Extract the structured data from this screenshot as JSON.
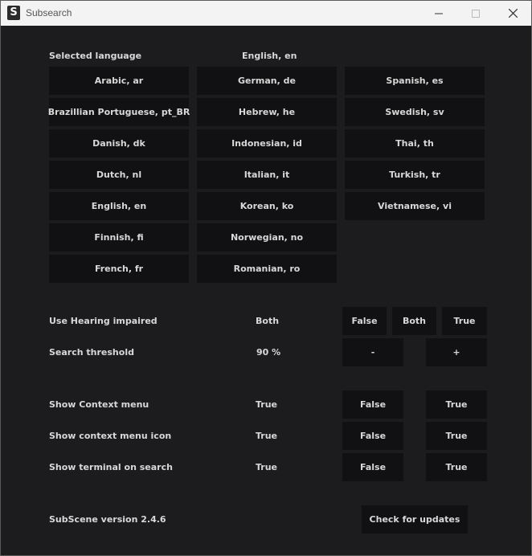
{
  "window": {
    "title": "Subsearch",
    "icon_letter": "S"
  },
  "languages": {
    "label": "Selected language",
    "selected": "English, en",
    "col1": [
      "Arabic, ar",
      "Brazillian Portuguese, pt_BR",
      "Danish, dk",
      "Dutch, nl",
      "English, en",
      "Finnish, fi",
      "French, fr"
    ],
    "col2": [
      "German, de",
      "Hebrew, he",
      "Indonesian, id",
      "Italian, it",
      "Korean, ko",
      "Norwegian, no",
      "Romanian, ro"
    ],
    "col3": [
      "Spanish, es",
      "Swedish, sv",
      "Thai, th",
      "Turkish, tr",
      "Vietnamese, vi"
    ]
  },
  "hearing_impaired": {
    "label": "Use Hearing impaired",
    "value": "Both",
    "btn_false": "False",
    "btn_both": "Both",
    "btn_true": "True"
  },
  "threshold": {
    "label": "Search threshold",
    "value": "90 %",
    "btn_minus": "-",
    "btn_plus": "+"
  },
  "context_menu": {
    "label": "Show Context menu",
    "value": "True",
    "btn_false": "False",
    "btn_true": "True"
  },
  "context_icon": {
    "label": "Show context menu icon",
    "value": "True",
    "btn_false": "False",
    "btn_true": "True"
  },
  "terminal": {
    "label": "Show terminal on search",
    "value": "True",
    "btn_false": "False",
    "btn_true": "True"
  },
  "version": {
    "label": "SubScene version 2.4.6",
    "update_button": "Check for updates"
  }
}
